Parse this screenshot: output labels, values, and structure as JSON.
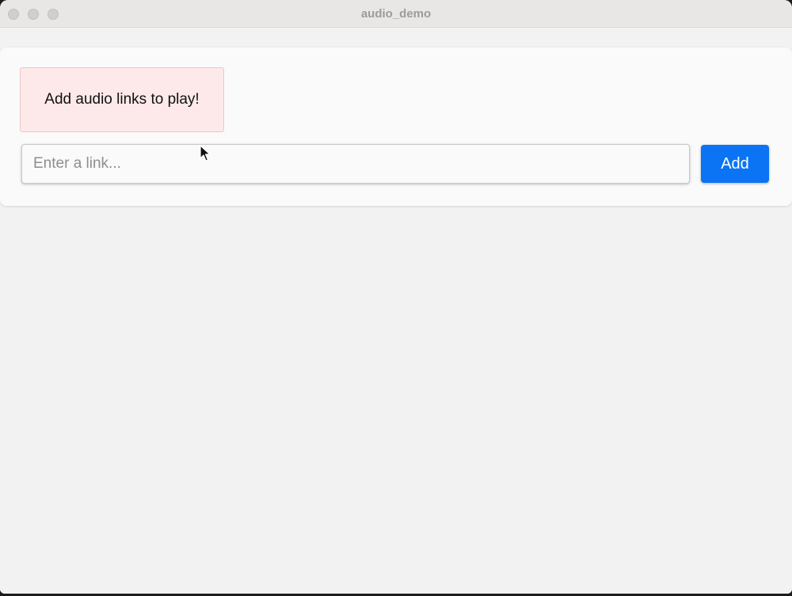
{
  "window": {
    "title": "audio_demo"
  },
  "notice": {
    "text": "Add audio links to play!",
    "background": "#fde9e9",
    "border": "#f1c4c4"
  },
  "link_input": {
    "value": "",
    "placeholder": "Enter a link..."
  },
  "add_button": {
    "label": "Add",
    "color": "#0a74f5"
  },
  "icons": {
    "cursor": "mouse-pointer-icon"
  }
}
